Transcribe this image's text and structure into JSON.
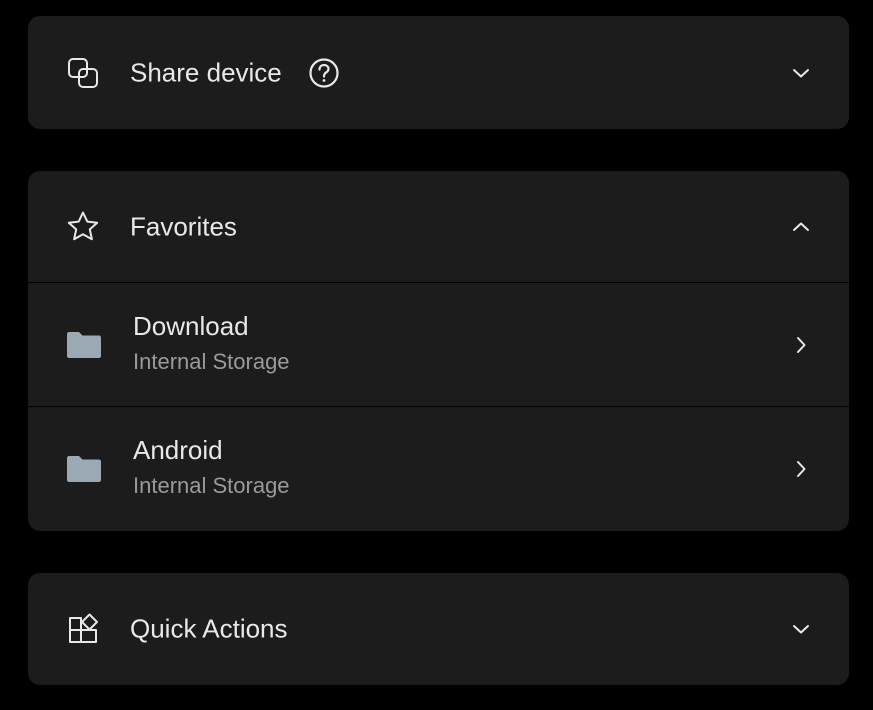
{
  "share_device": {
    "title": "Share device",
    "icon": "share-device-icon",
    "help_icon": "help-circle-icon",
    "expanded": false
  },
  "favorites": {
    "title": "Favorites",
    "icon": "star-icon",
    "expanded": true,
    "items": [
      {
        "label": "Download",
        "location": "Internal Storage",
        "icon": "folder-icon"
      },
      {
        "label": "Android",
        "location": "Internal Storage",
        "icon": "folder-icon"
      }
    ]
  },
  "quick_actions": {
    "title": "Quick Actions",
    "icon": "quick-actions-icon",
    "expanded": false
  },
  "colors": {
    "background": "#000000",
    "card": "#1c1c1c",
    "text_primary": "#e8e8e8",
    "text_secondary": "#9a9a9a",
    "folder": "#9aa9b3"
  }
}
